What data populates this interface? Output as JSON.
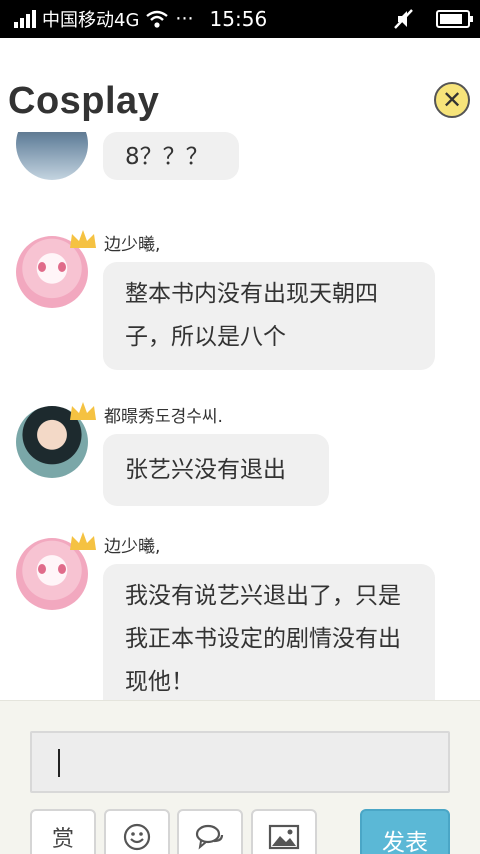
{
  "status_bar": {
    "carrier": "中国移动4G",
    "dots": "···",
    "time": "15:56",
    "battery_level": 0.85
  },
  "header": {
    "title": "Cosplay",
    "close_icon": "close-icon",
    "accent": "#f7e47a"
  },
  "messages": [
    {
      "username": "",
      "text": "8？？？",
      "avatar": "avatar-top"
    },
    {
      "username": "边少曦,",
      "text": "整本书内没有出现天朝四子，所以是八个",
      "avatar": "avatar-girl",
      "crown": true
    },
    {
      "username": "都暻秀도경수씨.",
      "text": "张艺兴没有退出",
      "avatar": "avatar-boy",
      "crown": true
    },
    {
      "username": "边少曦,",
      "text": "我没有说艺兴退出了，只是我正本书设定的剧情没有出现他！",
      "avatar": "avatar-girl",
      "crown": true
    }
  ],
  "composer": {
    "input_value": "",
    "reward_label": "赏",
    "emoji_icon": "smiley-icon",
    "comment_icon": "chat-bubbles-icon",
    "image_icon": "image-icon",
    "send_label": "发表",
    "send_color": "#5bb8d6"
  }
}
